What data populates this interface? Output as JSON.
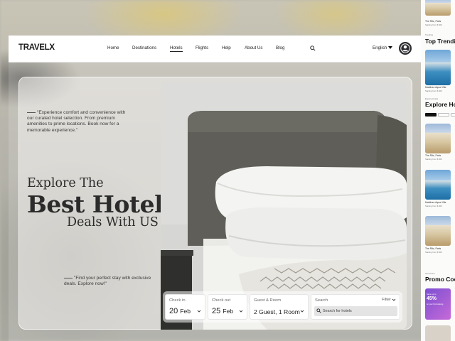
{
  "brand": {
    "name_main": "TRAVEL",
    "name_accent": "X"
  },
  "nav": {
    "items": [
      {
        "label": "Home"
      },
      {
        "label": "Destinations"
      },
      {
        "label": "Hotels"
      },
      {
        "label": "Flights"
      },
      {
        "label": "Help"
      },
      {
        "label": "About Us"
      },
      {
        "label": "Blog"
      }
    ],
    "active": "Hotels",
    "language": "English"
  },
  "hero": {
    "quote_top": "\"Experience comfort and convenience with our curated hotel selection. From premium amenities to prime locations. Book now for a memorable experience.\"",
    "title_line1": "Explore The",
    "title_line2": "Best Hotel",
    "title_line3": "Deals With US",
    "quote_bottom": "\"Find your perfect stay with exclusive deals. Explore now!\""
  },
  "booking": {
    "checkin": {
      "label": "Check in",
      "day": "20",
      "month": "Feb"
    },
    "checkout": {
      "label": "Check out",
      "day": "25",
      "month": "Feb"
    },
    "guests": {
      "label": "Guest & Room",
      "value": "2 Guest, 1 Room"
    },
    "search": {
      "label": "Search",
      "filter_label": "Filter",
      "placeholder": "Search for hotels"
    }
  },
  "mobile": {
    "cards": [
      {
        "name": "The Ritz, Paris",
        "price": "Starting from $ 000"
      },
      {
        "name": "Maldives Aqua Villa",
        "price": "Starting from $ 000"
      },
      {
        "name": "The Ritz, Paris",
        "price": "Starting from $ 000"
      },
      {
        "name": "Maldives Aqua Villa",
        "price": "Starting from $ 000"
      },
      {
        "name": "The Ritz, Paris",
        "price": "Starting from $ 000"
      }
    ],
    "section_trending_kicker": "Trending",
    "section_trending": "Top Trending",
    "section_explore_kicker": "Explore Hotels",
    "section_explore": "Explore Hotels",
    "section_promo_kicker": "Our Promo",
    "section_promo": "Promo Code",
    "promo": {
      "line1": "Save up to",
      "line2": "45%",
      "line3": "on your first booking"
    }
  },
  "colors": {
    "accent": "#1b1b1b",
    "avatar": "#2c2c30"
  }
}
